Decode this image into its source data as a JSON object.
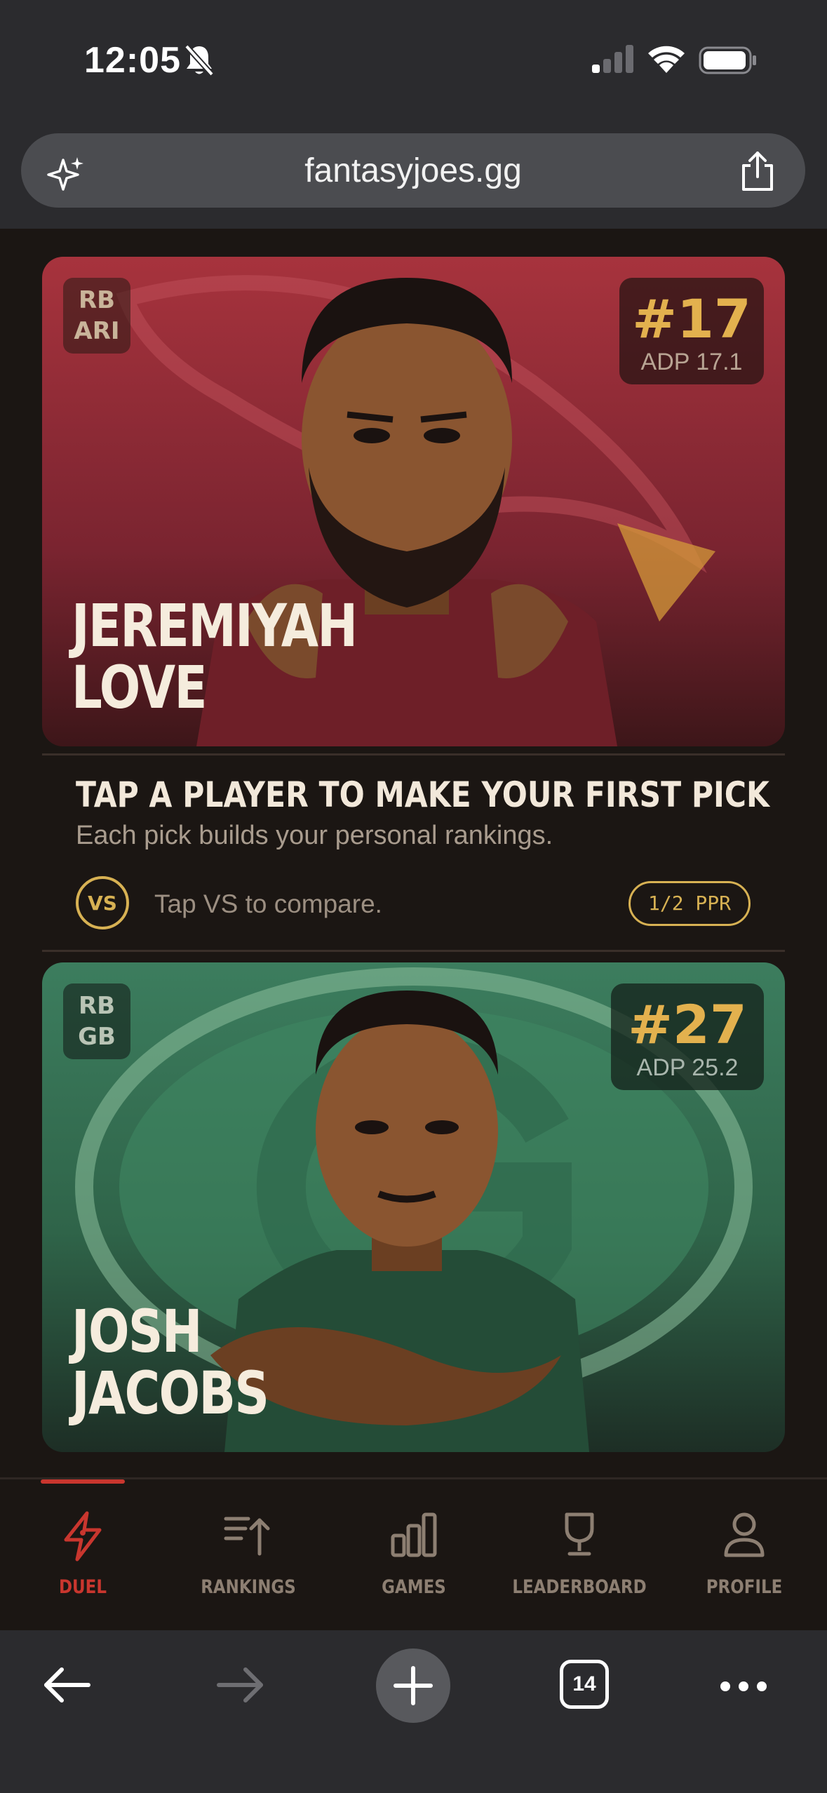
{
  "status": {
    "time": "12:05"
  },
  "browser": {
    "url": "fantasyjoes.gg",
    "tab_count": "14"
  },
  "duel": {
    "players": [
      {
        "position": "RB",
        "team": "ARI",
        "rank": "#17",
        "adp": "ADP 17.1",
        "first_name": "JEREMIYAH",
        "last_name": "LOVE",
        "team_color": "#a7333d"
      },
      {
        "position": "RB",
        "team": "GB",
        "rank": "#27",
        "adp": "ADP 25.2",
        "first_name": "JOSH",
        "last_name": "JACOBS",
        "team_color": "#3c7d5e"
      }
    ],
    "prompt_title": "TAP A PLAYER TO MAKE YOUR FIRST PICK",
    "prompt_subtitle": "Each pick builds your personal rankings.",
    "vs_label": "VS",
    "vs_hint": "Tap VS to compare.",
    "scoring": "1/2 PPR"
  },
  "nav": {
    "tabs": [
      {
        "label": "DUEL",
        "icon": "bolt-icon",
        "active": true
      },
      {
        "label": "RANKINGS",
        "icon": "sort-up-icon",
        "active": false
      },
      {
        "label": "GAMES",
        "icon": "bar-chart-icon",
        "active": false
      },
      {
        "label": "LEADERBOARD",
        "icon": "trophy-icon",
        "active": false
      },
      {
        "label": "PROFILE",
        "icon": "user-icon",
        "active": false
      }
    ]
  },
  "colors": {
    "accent_gold": "#d7b153",
    "accent_red": "#c9362e",
    "background": "#1b1613"
  }
}
